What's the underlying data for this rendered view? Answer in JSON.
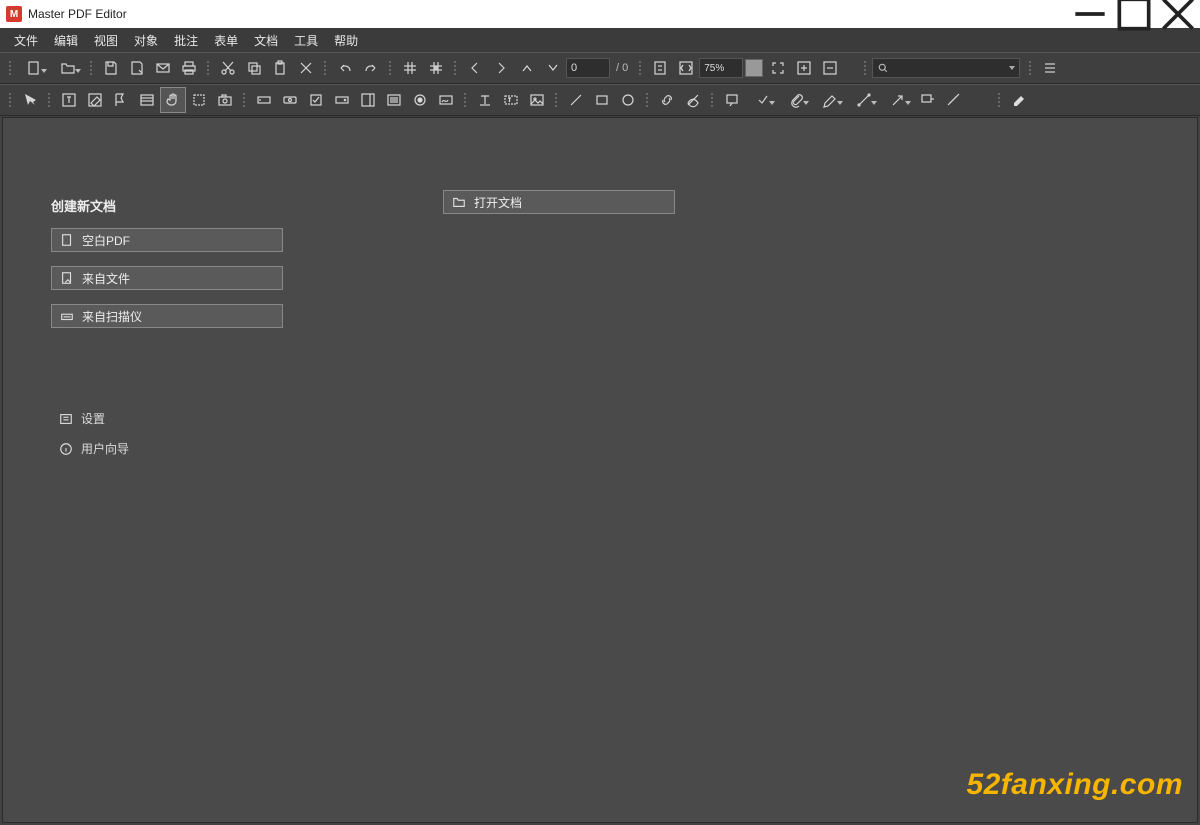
{
  "title": "Master PDF Editor",
  "app_icon_text": "M",
  "menu": {
    "file": "文件",
    "edit": "编辑",
    "view": "视图",
    "object": "对象",
    "annotate": "批注",
    "form": "表单",
    "document": "文档",
    "tools": "工具",
    "help": "帮助"
  },
  "toolbar1": {
    "page_value": "0",
    "page_total_prefix": " / ",
    "page_total": "0",
    "zoom": "75%"
  },
  "start": {
    "heading": "创建新文档",
    "blank_pdf": "空白PDF",
    "from_file": "来自文件",
    "from_scanner": "来自扫描仪",
    "open_doc": "打开文档",
    "settings": "设置",
    "user_guide": "用户向导"
  },
  "watermark": "52fanxing.com"
}
